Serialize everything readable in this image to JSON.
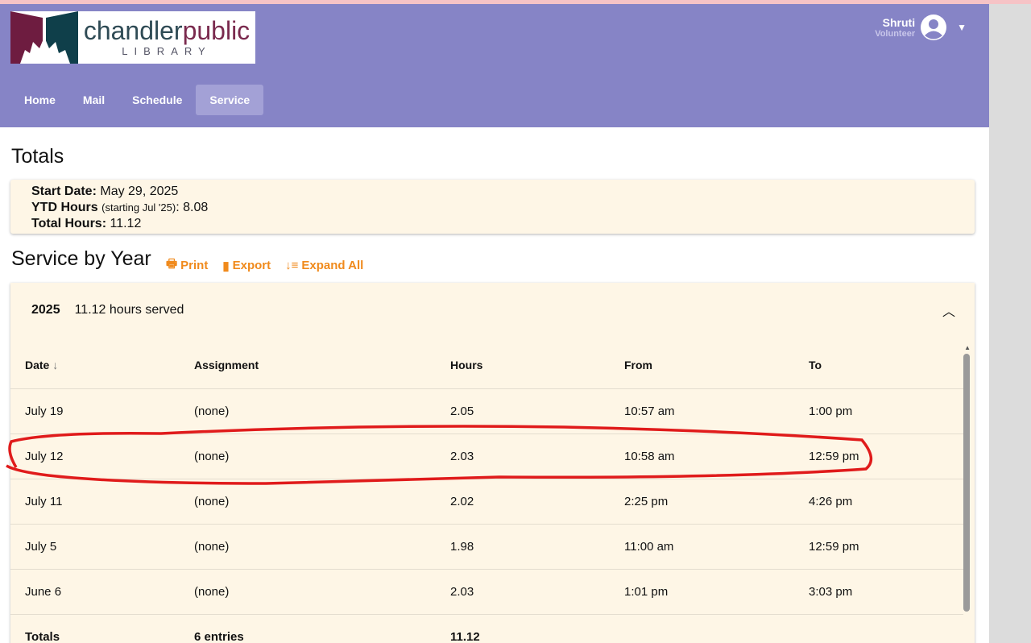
{
  "logo": {
    "brand_a": "chandler",
    "brand_b": "public",
    "sub": "LIBRARY"
  },
  "user": {
    "name": "Shruti",
    "role": "Volunteer"
  },
  "nav": [
    {
      "label": "Home"
    },
    {
      "label": "Mail"
    },
    {
      "label": "Schedule"
    },
    {
      "label": "Service"
    }
  ],
  "totals": {
    "title": "Totals",
    "start_label": "Start Date:",
    "start_value": "May 29, 2025",
    "ytd_label": "YTD Hours",
    "ytd_note": "(starting Jul '25)",
    "ytd_value": ": 8.08",
    "total_label": "Total Hours:",
    "total_value": "11.12"
  },
  "service": {
    "title": "Service by Year",
    "print": "Print",
    "export": "Export",
    "expand": "Expand All"
  },
  "year": {
    "year": "2025",
    "summary": "11.12 hours served",
    "columns": [
      "Date",
      "Assignment",
      "Hours",
      "From",
      "To"
    ],
    "rows": [
      [
        "July 19",
        "(none)",
        "2.05",
        "10:57 am",
        "1:00 pm"
      ],
      [
        "July 12",
        "(none)",
        "2.03",
        "10:58 am",
        "12:59 pm"
      ],
      [
        "July 11",
        "(none)",
        "2.02",
        "2:25 pm",
        "4:26 pm"
      ],
      [
        "July 5",
        "(none)",
        "1.98",
        "11:00 am",
        "12:59 pm"
      ],
      [
        "June 6",
        "(none)",
        "2.03",
        "1:01 pm",
        "3:03 pm"
      ]
    ],
    "totals_row": [
      "Totals",
      "6 entries",
      "11.12"
    ]
  },
  "colors": {
    "header": "#8684c6",
    "accent": "#f08a1c",
    "panel": "#fef6e6",
    "annotation": "#e01b1b"
  }
}
